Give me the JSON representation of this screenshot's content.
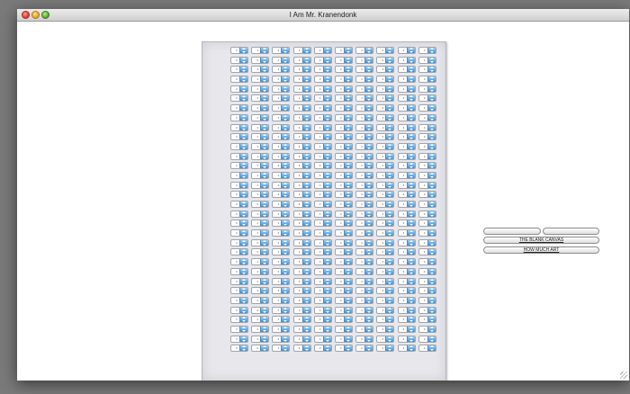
{
  "window": {
    "title": "I Am Mr. Kranendonk"
  },
  "grid": {
    "columns": 10,
    "rows": 32,
    "stepper_value": "•"
  },
  "side_buttons": {
    "button_left": "",
    "button_right": "",
    "blank_canvas": "THE BLANK CANVAS",
    "how_much_art": "HOW MUCH ART"
  },
  "colors": {
    "stepper_arrow": "#3a8fd8",
    "paper": "#e8e8ec"
  }
}
